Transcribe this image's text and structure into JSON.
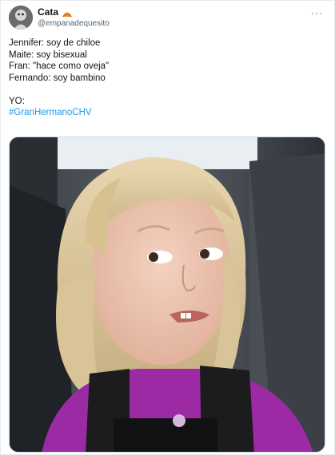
{
  "tweet": {
    "author": {
      "display_name": "Cata",
      "handle": "@empanadequesito",
      "badge_icon": "empanada-emoji-icon",
      "avatar_icon": "avatar-image"
    },
    "more_icon": "ellipsis-icon",
    "more_label": "···",
    "lines": [
      "Jennifer: soy de chiloe",
      "Maite: soy bisexual",
      "Fran: \"hace como oveja\"",
      "Fernando: soy bambino",
      "",
      "YO:"
    ],
    "hashtag": "#GranHermanoCHV",
    "media": {
      "kind": "photo",
      "description_icon": "meme-photo-girl-side-eye"
    }
  },
  "colors": {
    "link": "#1d9bf0",
    "text": "#0f1419",
    "muted": "#536471",
    "border": "#cfd9de",
    "badge": "#f08a24"
  }
}
